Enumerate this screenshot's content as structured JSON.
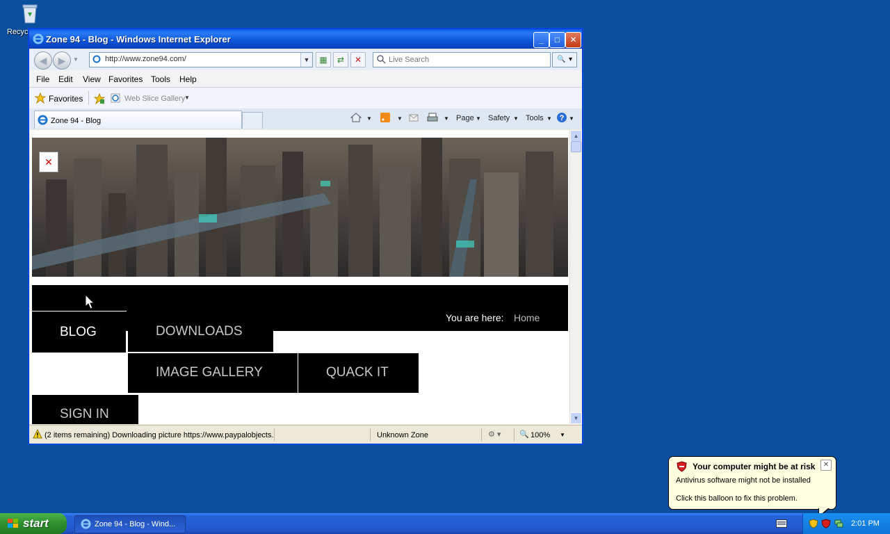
{
  "desktop": {
    "recycle_label": "Recyc"
  },
  "window": {
    "title": "Zone 94 - Blog - Windows Internet Explorer",
    "min": "_",
    "max": "□",
    "close": "✕"
  },
  "navbar": {
    "address": "http://www.zone94.com/",
    "search_placeholder": "Live Search"
  },
  "menu": [
    "File",
    "Edit",
    "View",
    "Favorites",
    "Tools",
    "Help"
  ],
  "favbar": {
    "favorites": "Favorites",
    "web_slice": "Web Slice Gallery"
  },
  "tab": {
    "label": "Zone 94 - Blog"
  },
  "commands": {
    "page": "Page",
    "safety": "Safety",
    "tools": "Tools"
  },
  "page": {
    "you_are_here": "You are here:",
    "breadcrumb_home": "Home",
    "menu": {
      "blog": "BLOG",
      "downloads": "DOWNLOADS",
      "gallery": "IMAGE GALLERY",
      "quack": "QUACK IT",
      "signin": "SIGN IN"
    }
  },
  "status": {
    "text": "(2 items remaining) Downloading picture https://www.paypalobjects.",
    "zone": "Unknown Zone",
    "zoom": "100%"
  },
  "taskbar": {
    "start": "start",
    "task": "Zone 94 - Blog - Wind...",
    "clock": "2:01 PM"
  },
  "balloon": {
    "title": "Your computer might be at risk",
    "line1": "Antivirus software might not be installed",
    "line2": "Click this balloon to fix this problem."
  },
  "colors": {
    "desktop": "#0a4f9e",
    "titlebar": "#0a5ee8",
    "taskbar": "#2358d0",
    "start": "#2d8f2d"
  }
}
